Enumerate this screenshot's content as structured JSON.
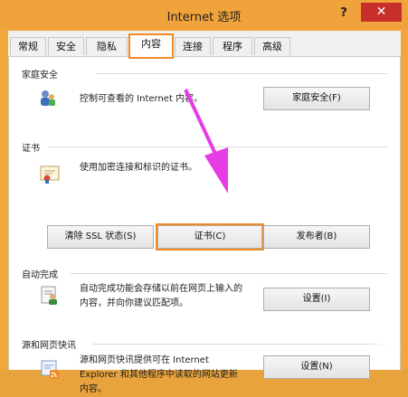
{
  "window": {
    "title": "Internet 选项",
    "help_glyph": "?",
    "close_glyph": "✕"
  },
  "tabs": [
    {
      "label": "常规"
    },
    {
      "label": "安全"
    },
    {
      "label": "隐私"
    },
    {
      "label": "内容",
      "active": true
    },
    {
      "label": "连接"
    },
    {
      "label": "程序"
    },
    {
      "label": "高级"
    }
  ],
  "family_safety": {
    "label": "家庭安全",
    "description": "控制可查看的 Internet 内容。",
    "button": "家庭安全(F)",
    "icon": "family-safety-icon"
  },
  "certificates": {
    "label": "证书",
    "description": "使用加密连接和标识的证书。",
    "buttons": {
      "clear_ssl": "清除 SSL 状态(S)",
      "certificates": "证书(C)",
      "publishers": "发布者(B)"
    },
    "icon": "certificate-icon"
  },
  "autocomplete": {
    "label": "自动完成",
    "description_lines": [
      "自动完成功能会存储以前在网页上输入的",
      "内容，并向你建议匹配项。"
    ],
    "button": "设置(I)",
    "icon": "autocomplete-icon"
  },
  "feeds": {
    "label": "源和网页快讯",
    "description_lines": [
      "源和网页快讯提供可在 Internet",
      "Explorer 和其他程序中读取的网站更新",
      "内容。"
    ],
    "button": "设置(N)",
    "icon": "feeds-icon"
  },
  "colors": {
    "highlight": "#f08a24",
    "arrow": "#e63ce6",
    "close": "#c7302a"
  }
}
